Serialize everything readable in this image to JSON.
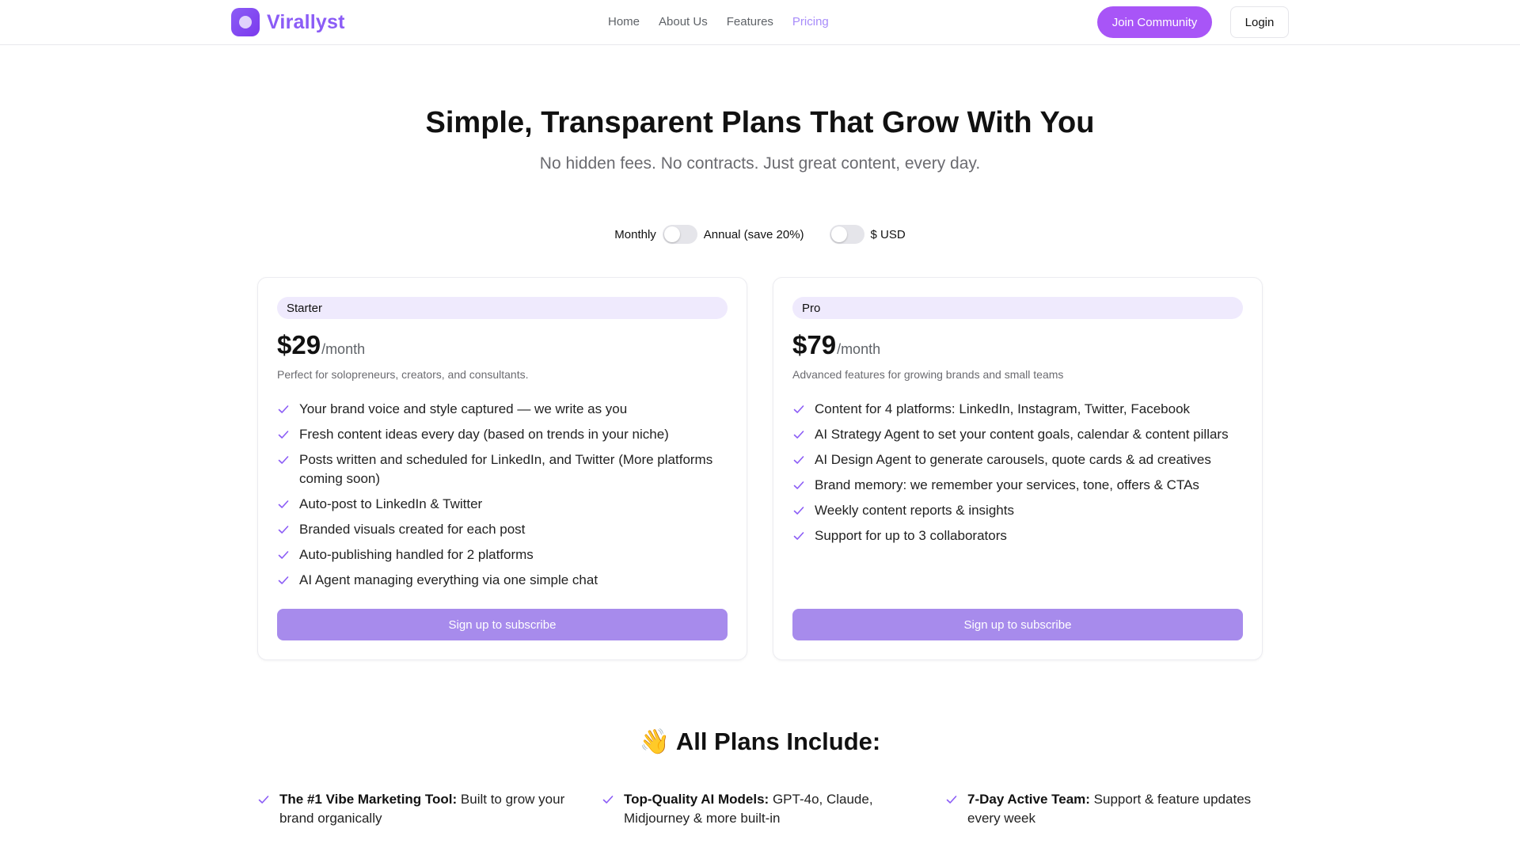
{
  "header": {
    "brand_name": "Virallyst",
    "nav": [
      {
        "label": "Home",
        "active": false
      },
      {
        "label": "About Us",
        "active": false
      },
      {
        "label": "Features",
        "active": false
      },
      {
        "label": "Pricing",
        "active": true
      }
    ],
    "join_label": "Join Community",
    "login_label": "Login"
  },
  "hero": {
    "title": "Simple, Transparent Plans That Grow With You",
    "subtitle": "No hidden fees. No contracts. Just great content, every day."
  },
  "toggles": {
    "monthly_label": "Monthly",
    "annual_label": "Annual (save 20%)",
    "annual_enabled": false,
    "currency_label": "$ USD",
    "currency_enabled": false
  },
  "plans": [
    {
      "name": "Starter",
      "price": "$29",
      "period": "/month",
      "description": "Perfect for solopreneurs, creators, and consultants.",
      "features": [
        "Your brand voice and style captured — we write as you",
        "Fresh content ideas every day (based on trends in your niche)",
        "Posts written and scheduled for LinkedIn, and Twitter (More platforms coming soon)",
        "Auto-post to LinkedIn & Twitter",
        "Branded visuals created for each post",
        "Auto-publishing handled for 2 platforms",
        "AI Agent managing everything via one simple chat"
      ],
      "cta": "Sign up to subscribe"
    },
    {
      "name": "Pro",
      "price": "$79",
      "period": "/month",
      "description": "Advanced features for growing brands and small teams",
      "features": [
        "Content for 4 platforms: LinkedIn, Instagram, Twitter, Facebook",
        "AI Strategy Agent to set your content goals, calendar & content pillars",
        "AI Design Agent to generate carousels, quote cards & ad creatives",
        "Brand memory: we remember your services, tone, offers & CTAs",
        "Weekly content reports & insights",
        "Support for up to 3 collaborators"
      ],
      "cta": "Sign up to subscribe"
    }
  ],
  "all_plans": {
    "title": "👋 All Plans Include:",
    "items": [
      {
        "bold": "The #1 Vibe Marketing Tool:",
        "text": " Built to grow your brand organically"
      },
      {
        "bold": "Top-Quality AI Models:",
        "text": " GPT-4o, Claude, Midjourney & more built-in"
      },
      {
        "bold": "7-Day Active Team:",
        "text": " Support & feature updates every week"
      }
    ]
  },
  "colors": {
    "brand": "#8b5cf6",
    "join_button": "#a855f7",
    "subscribe_button": "#a78bec",
    "check": "#8b5cf6",
    "active_nav": "#a78bfa"
  },
  "icons": {
    "logo": "rounded-square-dot-logo",
    "feature_check": "check-icon"
  }
}
